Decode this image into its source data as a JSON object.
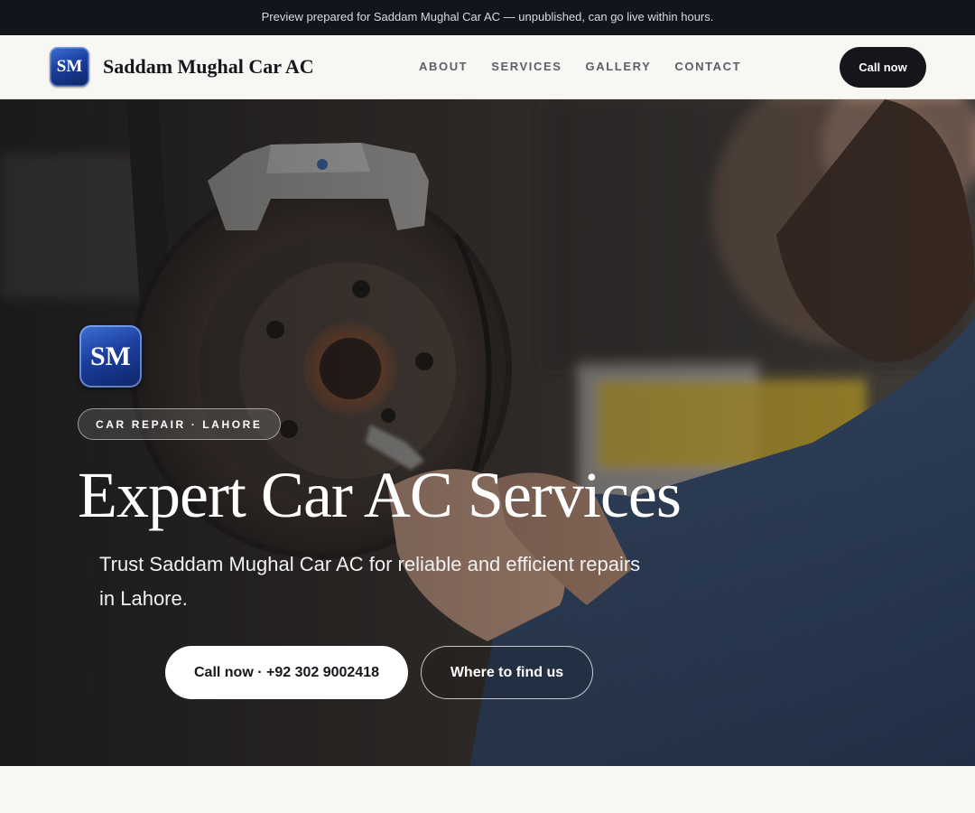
{
  "banner": {
    "text": "Preview prepared for Saddam Mughal Car AC — unpublished, can go live within hours."
  },
  "header": {
    "logo_initials": "SM",
    "brand": "Saddam Mughal Car AC",
    "nav": [
      "ABOUT",
      "SERVICES",
      "GALLERY",
      "CONTACT"
    ],
    "call_label": "Call now"
  },
  "hero": {
    "badge_initials": "SM",
    "tag": "CAR REPAIR · LAHORE",
    "title": "Expert Car AC Services",
    "subtitle": "Trust Saddam Mughal Car AC for reliable and efficient repairs in Lahore.",
    "primary_button": "Call now · +92 302 9002418",
    "secondary_button": "Where to find us",
    "background_image": "mechanic working on car brake disc"
  },
  "colors": {
    "banner_bg": "#12151b",
    "page_bg": "#f8f7f4",
    "text_dark": "#14161b",
    "nav_text": "#5b6068",
    "logo_blue": "#1b3f9e"
  }
}
